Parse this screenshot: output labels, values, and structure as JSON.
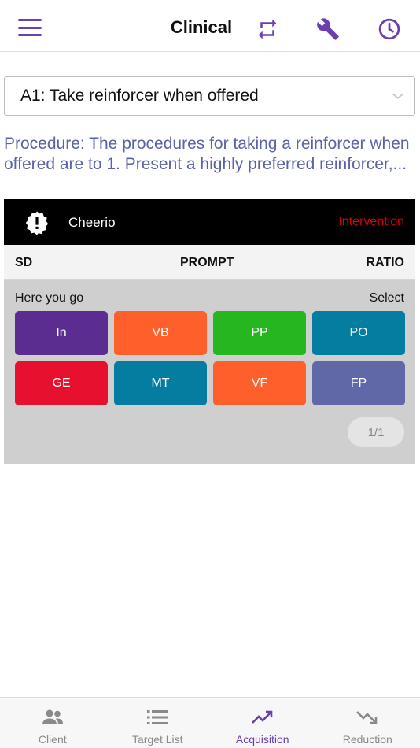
{
  "header": {
    "title": "Clinical"
  },
  "dropdown": {
    "value": "A1: Take reinforcer when offered"
  },
  "procedure": {
    "text": "Procedure: The procedures for taking a reinforcer when offered are to 1. Present a highly preferred reinforcer,..."
  },
  "target": {
    "name": "Cheerio",
    "phase": "Intervention"
  },
  "columns": {
    "sd": "SD",
    "prompt": "PROMPT",
    "ratio": "RATIO"
  },
  "trial": {
    "sd": "Here you go",
    "select": "Select"
  },
  "prompts": [
    {
      "label": "In",
      "color": "#5b2d91"
    },
    {
      "label": "VB",
      "color": "#ff5f2a"
    },
    {
      "label": "PP",
      "color": "#25b620"
    },
    {
      "label": "PO",
      "color": "#047da0"
    },
    {
      "label": "GE",
      "color": "#e8102f"
    },
    {
      "label": "MT",
      "color": "#047da0"
    },
    {
      "label": "VF",
      "color": "#ff5f2a"
    },
    {
      "label": "FP",
      "color": "#6068a8"
    }
  ],
  "pagination": {
    "label": "1/1"
  },
  "nav": [
    {
      "label": "Client",
      "icon": "people-icon"
    },
    {
      "label": "Target List",
      "icon": "list-icon"
    },
    {
      "label": "Acquisition",
      "icon": "trending-up-icon",
      "active": true
    },
    {
      "label": "Reduction",
      "icon": "trending-down-icon"
    }
  ],
  "colors": {
    "accent": "#6a3fb0",
    "procedure": "#5b63a8",
    "phase": "#d8000c"
  }
}
